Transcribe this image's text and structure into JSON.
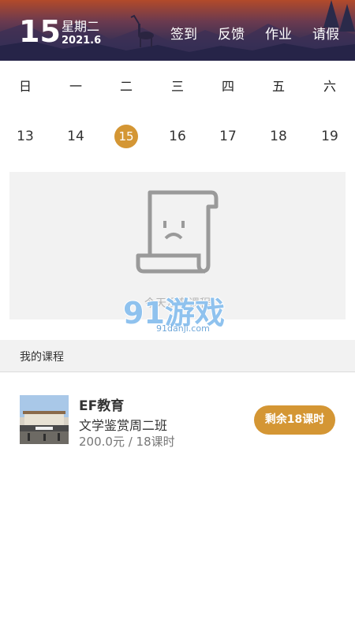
{
  "header": {
    "day": "15",
    "weekday": "星期二",
    "year_month": "2021.6",
    "nav": [
      "签到",
      "反馈",
      "作业",
      "请假"
    ]
  },
  "calendar": {
    "weekday_labels": [
      "日",
      "一",
      "二",
      "三",
      "四",
      "五",
      "六"
    ],
    "dates": [
      "13",
      "14",
      "15",
      "16",
      "17",
      "18",
      "19"
    ],
    "selected": "15"
  },
  "empty_state": {
    "text": "今天没有课程"
  },
  "watermark": {
    "logo_text": "91游戏",
    "site": "91danji.com"
  },
  "section": {
    "title": "我的课程"
  },
  "course": {
    "org": "EF教育",
    "name": "文学鉴赏周二班",
    "price": "200.0元 / 18课时",
    "remaining": "剩余18课时"
  },
  "colors": {
    "accent": "#d49634",
    "header_top": "#b24a2a",
    "header_bottom": "#24264a"
  }
}
